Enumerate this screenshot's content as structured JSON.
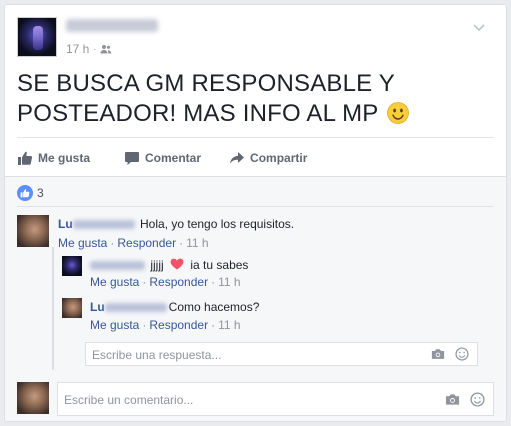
{
  "post": {
    "time": "17 h",
    "audience_icon": "friends-icon",
    "text": "SE BUSCA GM RESPONSABLE Y POSTEADOR! MAS INFO AL MP",
    "emoji": "smile-emoji"
  },
  "actions": {
    "like_label": "Me gusta",
    "comment_label": "Comentar",
    "share_label": "Compartir"
  },
  "reactions": {
    "count": "3"
  },
  "comments": [
    {
      "name_start": "Lu",
      "text": "Hola, yo tengo los requisitos.",
      "like": "Me gusta",
      "reply": "Responder",
      "time": "11 h"
    }
  ],
  "replies": [
    {
      "text_before": "jjjjj",
      "text_after": "ia tu sabes",
      "like": "Me gusta",
      "reply": "Responder",
      "time": "11 h"
    },
    {
      "name_start": "Lu",
      "text": "Como hacemos?",
      "like": "Me gusta",
      "reply": "Responder",
      "time": "11 h"
    }
  ],
  "reply_input": {
    "placeholder": "Escribe una respuesta..."
  },
  "comment_input": {
    "placeholder": "Escribe un comentario..."
  },
  "separator": "·",
  "colors": {
    "link": "#365899",
    "like_bubble": "#5890ff",
    "heart": "#f25268"
  }
}
